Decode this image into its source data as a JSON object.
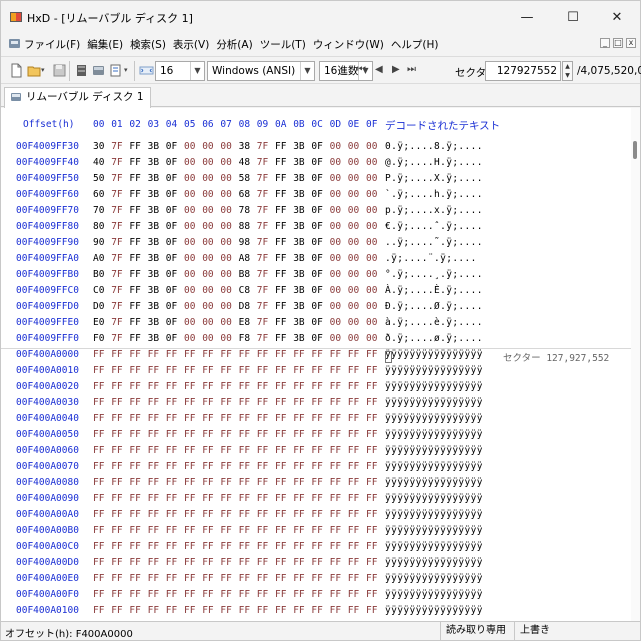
{
  "window": {
    "title": "HxD - [リムーバブル ディスク 1]",
    "minimize_glyph": "—",
    "maximize_glyph": "☐",
    "close_glyph": "✕"
  },
  "menu": {
    "items": [
      "ファイル(F)",
      "編集(E)",
      "検索(S)",
      "表示(V)",
      "分析(A)",
      "ツール(T)",
      "ウィンドウ(W)",
      "ヘルプ(H)"
    ],
    "mdi_minimize": "_",
    "mdi_restore": "□",
    "mdi_close": "x"
  },
  "toolbar": {
    "bytes_per_row": "16",
    "charset": "Windows (ANSI)",
    "offset_base": "16進数",
    "sector_label": "セクター",
    "sector_value": "127927552",
    "sector_total": "/4,075,520,000",
    "nav_first": "⏮",
    "nav_prev": "◀",
    "nav_next": "▶",
    "nav_last": "⏭"
  },
  "tab": {
    "label": "リムーバブル ディスク 1"
  },
  "editor": {
    "offset_header": "Offset(h)",
    "column_headers": [
      "00",
      "01",
      "02",
      "03",
      "04",
      "05",
      "06",
      "07",
      "08",
      "09",
      "0A",
      "0B",
      "0C",
      "0D",
      "0E",
      "0F"
    ],
    "text_header": "デコードされたテキスト",
    "sector_label": "セクター 127,927,552",
    "rows": [
      {
        "offset": "00F4009FF30",
        "bytes": [
          "30",
          "7F",
          "FF",
          "3B",
          "0F",
          "00",
          "00",
          "00",
          "38",
          "7F",
          "FF",
          "3B",
          "0F",
          "00",
          "00",
          "00"
        ],
        "text": "0.ÿ;....8.ÿ;...."
      },
      {
        "offset": "00F4009FF40",
        "bytes": [
          "40",
          "7F",
          "FF",
          "3B",
          "0F",
          "00",
          "00",
          "00",
          "48",
          "7F",
          "FF",
          "3B",
          "0F",
          "00",
          "00",
          "00"
        ],
        "text": "@.ÿ;....H.ÿ;...."
      },
      {
        "offset": "00F4009FF50",
        "bytes": [
          "50",
          "7F",
          "FF",
          "3B",
          "0F",
          "00",
          "00",
          "00",
          "58",
          "7F",
          "FF",
          "3B",
          "0F",
          "00",
          "00",
          "00"
        ],
        "text": "P.ÿ;....X.ÿ;...."
      },
      {
        "offset": "00F4009FF60",
        "bytes": [
          "60",
          "7F",
          "FF",
          "3B",
          "0F",
          "00",
          "00",
          "00",
          "68",
          "7F",
          "FF",
          "3B",
          "0F",
          "00",
          "00",
          "00"
        ],
        "text": "`.ÿ;....h.ÿ;...."
      },
      {
        "offset": "00F4009FF70",
        "bytes": [
          "70",
          "7F",
          "FF",
          "3B",
          "0F",
          "00",
          "00",
          "00",
          "78",
          "7F",
          "FF",
          "3B",
          "0F",
          "00",
          "00",
          "00"
        ],
        "text": "p.ÿ;....x.ÿ;...."
      },
      {
        "offset": "00F4009FF80",
        "bytes": [
          "80",
          "7F",
          "FF",
          "3B",
          "0F",
          "00",
          "00",
          "00",
          "88",
          "7F",
          "FF",
          "3B",
          "0F",
          "00",
          "00",
          "00"
        ],
        "text": "€.ÿ;....ˆ.ÿ;...."
      },
      {
        "offset": "00F4009FF90",
        "bytes": [
          "90",
          "7F",
          "FF",
          "3B",
          "0F",
          "00",
          "00",
          "00",
          "98",
          "7F",
          "FF",
          "3B",
          "0F",
          "00",
          "00",
          "00"
        ],
        "text": "..ÿ;....˜.ÿ;...."
      },
      {
        "offset": "00F4009FFA0",
        "bytes": [
          "A0",
          "7F",
          "FF",
          "3B",
          "0F",
          "00",
          "00",
          "00",
          "A8",
          "7F",
          "FF",
          "3B",
          "0F",
          "00",
          "00",
          "00"
        ],
        "text": " .ÿ;....¨.ÿ;...."
      },
      {
        "offset": "00F4009FFB0",
        "bytes": [
          "B0",
          "7F",
          "FF",
          "3B",
          "0F",
          "00",
          "00",
          "00",
          "B8",
          "7F",
          "FF",
          "3B",
          "0F",
          "00",
          "00",
          "00"
        ],
        "text": "°.ÿ;....¸.ÿ;...."
      },
      {
        "offset": "00F4009FFC0",
        "bytes": [
          "C0",
          "7F",
          "FF",
          "3B",
          "0F",
          "00",
          "00",
          "00",
          "C8",
          "7F",
          "FF",
          "3B",
          "0F",
          "00",
          "00",
          "00"
        ],
        "text": "À.ÿ;....È.ÿ;...."
      },
      {
        "offset": "00F4009FFD0",
        "bytes": [
          "D0",
          "7F",
          "FF",
          "3B",
          "0F",
          "00",
          "00",
          "00",
          "D8",
          "7F",
          "FF",
          "3B",
          "0F",
          "00",
          "00",
          "00"
        ],
        "text": "Ð.ÿ;....Ø.ÿ;...."
      },
      {
        "offset": "00F4009FFE0",
        "bytes": [
          "E0",
          "7F",
          "FF",
          "3B",
          "0F",
          "00",
          "00",
          "00",
          "E8",
          "7F",
          "FF",
          "3B",
          "0F",
          "00",
          "00",
          "00"
        ],
        "text": "à.ÿ;....è.ÿ;...."
      },
      {
        "offset": "00F4009FFF0",
        "bytes": [
          "F0",
          "7F",
          "FF",
          "3B",
          "0F",
          "00",
          "00",
          "00",
          "F8",
          "7F",
          "FF",
          "3B",
          "0F",
          "00",
          "00",
          "00"
        ],
        "text": "ð.ÿ;....ø.ÿ;...."
      },
      {
        "offset": "00F400A0000",
        "bytes": [
          "FF",
          "FF",
          "FF",
          "FF",
          "FF",
          "FF",
          "FF",
          "FF",
          "FF",
          "FF",
          "FF",
          "FF",
          "FF",
          "FF",
          "FF",
          "FF"
        ],
        "text": "ÿÿÿÿÿÿÿÿÿÿÿÿÿÿÿÿ"
      },
      {
        "offset": "00F400A0010",
        "bytes": [
          "FF",
          "FF",
          "FF",
          "FF",
          "FF",
          "FF",
          "FF",
          "FF",
          "FF",
          "FF",
          "FF",
          "FF",
          "FF",
          "FF",
          "FF",
          "FF"
        ],
        "text": "ÿÿÿÿÿÿÿÿÿÿÿÿÿÿÿÿ"
      },
      {
        "offset": "00F400A0020",
        "bytes": [
          "FF",
          "FF",
          "FF",
          "FF",
          "FF",
          "FF",
          "FF",
          "FF",
          "FF",
          "FF",
          "FF",
          "FF",
          "FF",
          "FF",
          "FF",
          "FF"
        ],
        "text": "ÿÿÿÿÿÿÿÿÿÿÿÿÿÿÿÿ"
      },
      {
        "offset": "00F400A0030",
        "bytes": [
          "FF",
          "FF",
          "FF",
          "FF",
          "FF",
          "FF",
          "FF",
          "FF",
          "FF",
          "FF",
          "FF",
          "FF",
          "FF",
          "FF",
          "FF",
          "FF"
        ],
        "text": "ÿÿÿÿÿÿÿÿÿÿÿÿÿÿÿÿ"
      },
      {
        "offset": "00F400A0040",
        "bytes": [
          "FF",
          "FF",
          "FF",
          "FF",
          "FF",
          "FF",
          "FF",
          "FF",
          "FF",
          "FF",
          "FF",
          "FF",
          "FF",
          "FF",
          "FF",
          "FF"
        ],
        "text": "ÿÿÿÿÿÿÿÿÿÿÿÿÿÿÿÿ"
      },
      {
        "offset": "00F400A0050",
        "bytes": [
          "FF",
          "FF",
          "FF",
          "FF",
          "FF",
          "FF",
          "FF",
          "FF",
          "FF",
          "FF",
          "FF",
          "FF",
          "FF",
          "FF",
          "FF",
          "FF"
        ],
        "text": "ÿÿÿÿÿÿÿÿÿÿÿÿÿÿÿÿ"
      },
      {
        "offset": "00F400A0060",
        "bytes": [
          "FF",
          "FF",
          "FF",
          "FF",
          "FF",
          "FF",
          "FF",
          "FF",
          "FF",
          "FF",
          "FF",
          "FF",
          "FF",
          "FF",
          "FF",
          "FF"
        ],
        "text": "ÿÿÿÿÿÿÿÿÿÿÿÿÿÿÿÿ"
      },
      {
        "offset": "00F400A0070",
        "bytes": [
          "FF",
          "FF",
          "FF",
          "FF",
          "FF",
          "FF",
          "FF",
          "FF",
          "FF",
          "FF",
          "FF",
          "FF",
          "FF",
          "FF",
          "FF",
          "FF"
        ],
        "text": "ÿÿÿÿÿÿÿÿÿÿÿÿÿÿÿÿ"
      },
      {
        "offset": "00F400A0080",
        "bytes": [
          "FF",
          "FF",
          "FF",
          "FF",
          "FF",
          "FF",
          "FF",
          "FF",
          "FF",
          "FF",
          "FF",
          "FF",
          "FF",
          "FF",
          "FF",
          "FF"
        ],
        "text": "ÿÿÿÿÿÿÿÿÿÿÿÿÿÿÿÿ"
      },
      {
        "offset": "00F400A0090",
        "bytes": [
          "FF",
          "FF",
          "FF",
          "FF",
          "FF",
          "FF",
          "FF",
          "FF",
          "FF",
          "FF",
          "FF",
          "FF",
          "FF",
          "FF",
          "FF",
          "FF"
        ],
        "text": "ÿÿÿÿÿÿÿÿÿÿÿÿÿÿÿÿ"
      },
      {
        "offset": "00F400A00A0",
        "bytes": [
          "FF",
          "FF",
          "FF",
          "FF",
          "FF",
          "FF",
          "FF",
          "FF",
          "FF",
          "FF",
          "FF",
          "FF",
          "FF",
          "FF",
          "FF",
          "FF"
        ],
        "text": "ÿÿÿÿÿÿÿÿÿÿÿÿÿÿÿÿ"
      },
      {
        "offset": "00F400A00B0",
        "bytes": [
          "FF",
          "FF",
          "FF",
          "FF",
          "FF",
          "FF",
          "FF",
          "FF",
          "FF",
          "FF",
          "FF",
          "FF",
          "FF",
          "FF",
          "FF",
          "FF"
        ],
        "text": "ÿÿÿÿÿÿÿÿÿÿÿÿÿÿÿÿ"
      },
      {
        "offset": "00F400A00C0",
        "bytes": [
          "FF",
          "FF",
          "FF",
          "FF",
          "FF",
          "FF",
          "FF",
          "FF",
          "FF",
          "FF",
          "FF",
          "FF",
          "FF",
          "FF",
          "FF",
          "FF"
        ],
        "text": "ÿÿÿÿÿÿÿÿÿÿÿÿÿÿÿÿ"
      },
      {
        "offset": "00F400A00D0",
        "bytes": [
          "FF",
          "FF",
          "FF",
          "FF",
          "FF",
          "FF",
          "FF",
          "FF",
          "FF",
          "FF",
          "FF",
          "FF",
          "FF",
          "FF",
          "FF",
          "FF"
        ],
        "text": "ÿÿÿÿÿÿÿÿÿÿÿÿÿÿÿÿ"
      },
      {
        "offset": "00F400A00E0",
        "bytes": [
          "FF",
          "FF",
          "FF",
          "FF",
          "FF",
          "FF",
          "FF",
          "FF",
          "FF",
          "FF",
          "FF",
          "FF",
          "FF",
          "FF",
          "FF",
          "FF"
        ],
        "text": "ÿÿÿÿÿÿÿÿÿÿÿÿÿÿÿÿ"
      },
      {
        "offset": "00F400A00F0",
        "bytes": [
          "FF",
          "FF",
          "FF",
          "FF",
          "FF",
          "FF",
          "FF",
          "FF",
          "FF",
          "FF",
          "FF",
          "FF",
          "FF",
          "FF",
          "FF",
          "FF"
        ],
        "text": "ÿÿÿÿÿÿÿÿÿÿÿÿÿÿÿÿ"
      },
      {
        "offset": "00F400A0100",
        "bytes": [
          "FF",
          "FF",
          "FF",
          "FF",
          "FF",
          "FF",
          "FF",
          "FF",
          "FF",
          "FF",
          "FF",
          "FF",
          "FF",
          "FF",
          "FF",
          "FF"
        ],
        "text": "ÿÿÿÿÿÿÿÿÿÿÿÿÿÿÿÿ"
      }
    ]
  },
  "status": {
    "offset": "オフセット(h): F400A0000",
    "mode": "読み取り専用",
    "write": "上書き"
  },
  "colors": {
    "offset_blue": "#1a2fd4",
    "zero_byte_red": "#8a3a3a",
    "background": "#f3f3f3"
  }
}
